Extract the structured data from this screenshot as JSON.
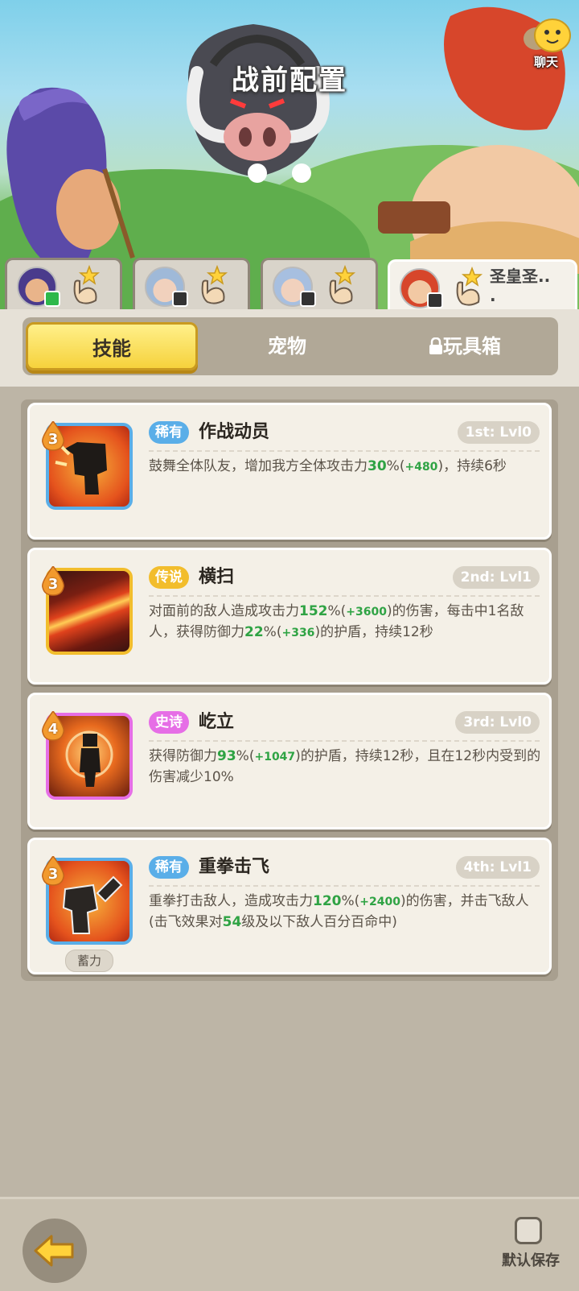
{
  "header": {
    "title": "战前配置",
    "chat_label": "聊天"
  },
  "hero_tabs": [
    {
      "name": "",
      "badge": "green"
    },
    {
      "name": "",
      "badge": "dark"
    },
    {
      "name": "",
      "badge": "dark"
    },
    {
      "name": "圣皇圣..\n.",
      "badge": "dark",
      "active": true
    }
  ],
  "category_tabs": [
    {
      "label": "技能",
      "active": true
    },
    {
      "label": "宠物",
      "active": false
    },
    {
      "label": "玩具箱",
      "active": false,
      "locked": true
    }
  ],
  "skills": [
    {
      "level": "3",
      "rarity": "稀有",
      "rarity_color": "#5aaee8",
      "name": "作战动员",
      "slot": "1st: Lvl0",
      "desc_html": "鼓舞全体队友，增加我方全体攻击力<b>30</b>%(<small>+480</small>)，持续6秒",
      "icon": "rally-icon"
    },
    {
      "level": "3",
      "rarity": "传说",
      "rarity_color": "#f2bd2c",
      "name": "横扫",
      "slot": "2nd: Lvl1",
      "desc_html": "对面前的敌人造成攻击力<b>152</b>%(<small>+3600</small>)的伤害，每击中1名敌人，获得防御力<b>22</b>%(<small>+336</small>)的护盾，持续12秒",
      "icon": "sweep-icon"
    },
    {
      "level": "4",
      "rarity": "史诗",
      "rarity_color": "#e66ee6",
      "name": "屹立",
      "slot": "3rd: Lvl0",
      "desc_html": "获得防御力<b>93</b>%(<small>+1047</small>)的护盾，持续12秒，且在12秒内受到的伤害减少10%",
      "icon": "stand-icon"
    },
    {
      "level": "3",
      "rarity": "稀有",
      "rarity_color": "#5aaee8",
      "name": "重拳击飞",
      "slot": "4th: Lvl1",
      "desc_html": "重拳打击敌人，造成攻击力<b>120</b>%(<small>+2400</small>)的伤害，并击飞敌人(击飞效果对<b>54</b>级及以下敌人百分百命中)",
      "icon": "punch-icon",
      "extra_badge": "蓄力"
    }
  ],
  "footer": {
    "save_label": "默认保存"
  },
  "colors": {
    "accent_yellow": "#f6d23c",
    "panel": "#f4f0e7",
    "green_stat": "#2fa344"
  }
}
